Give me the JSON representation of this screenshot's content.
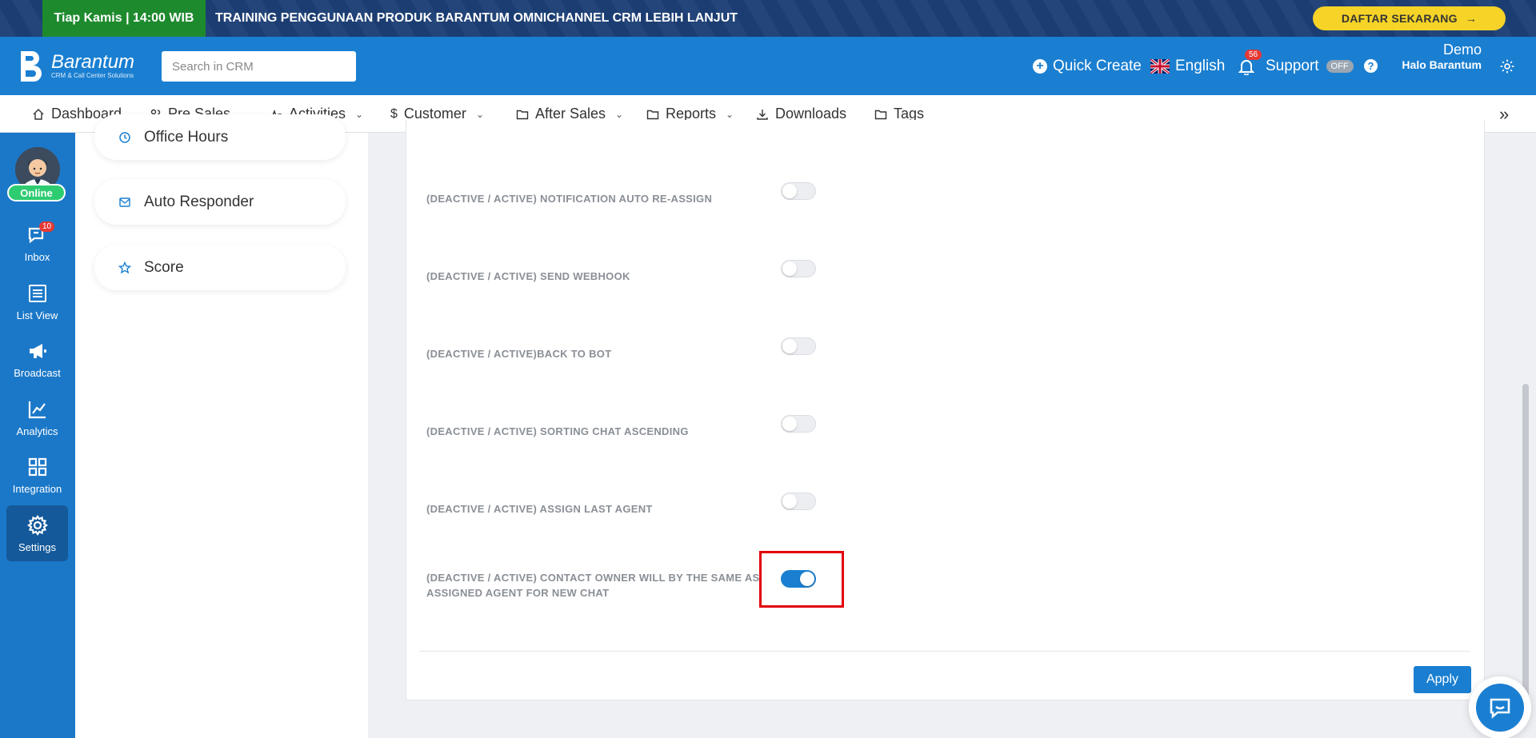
{
  "promo": {
    "badge": "Tiap Kamis | 14:00 WIB",
    "text": "TRAINING PENGGUNAAN PRODUK BARANTUM OMNICHANNEL CRM LEBIH LANJUT",
    "cta": "DAFTAR SEKARANG"
  },
  "header": {
    "brand": "Barantum",
    "brand_sub": "CRM & Call Center Solutions",
    "search_placeholder": "Search in CRM",
    "quick_create": "Quick Create",
    "language": "English",
    "notif_count": "56",
    "support": "Support",
    "support_status": "OFF",
    "help": "?",
    "user_name": "Demo",
    "user_sub": "Halo Barantum"
  },
  "nav": {
    "items": [
      {
        "label": "Dashboard",
        "icon": "home-icon"
      },
      {
        "label": "Pre Sales",
        "icon": "users-icon"
      },
      {
        "label": "Activities",
        "icon": "activity-icon"
      },
      {
        "label": "Customer",
        "icon": "dollar-icon"
      },
      {
        "label": "After Sales",
        "icon": "folder-icon"
      },
      {
        "label": "Reports",
        "icon": "folder-icon"
      },
      {
        "label": "Downloads",
        "icon": "download-icon"
      },
      {
        "label": "Tags",
        "icon": "folder-icon"
      }
    ],
    "more": "»"
  },
  "rail": {
    "status": "Online",
    "inbox_count": "10",
    "items": [
      "Inbox",
      "List View",
      "Broadcast",
      "Analytics",
      "Integration",
      "Settings"
    ]
  },
  "submenu": {
    "items": [
      "Office Hours",
      "Auto Responder",
      "Score"
    ]
  },
  "settings": {
    "rows": [
      {
        "label": "(DEACTIVE / ACTIVE) NOTIFICATION AUTO RE-ASSIGN",
        "enabled": false
      },
      {
        "label": "(DEACTIVE / ACTIVE) SEND WEBHOOK",
        "enabled": false
      },
      {
        "label": "(DEACTIVE / ACTIVE)BACK TO BOT",
        "enabled": false
      },
      {
        "label": "(DEACTIVE / ACTIVE) SORTING CHAT ASCENDING",
        "enabled": false
      },
      {
        "label": "(DEACTIVE / ACTIVE) ASSIGN LAST AGENT",
        "enabled": false
      },
      {
        "label": "(DEACTIVE / ACTIVE) CONTACT OWNER WILL BY THE SAME AS ASSIGNED AGENT FOR NEW CHAT",
        "enabled": true
      }
    ],
    "apply_label": "Apply"
  },
  "colors": {
    "primary": "#1a7fd1",
    "promo_bg": "#1c3f75",
    "promo_badge": "#1e8a2e",
    "cta": "#f5d327",
    "highlight": "#e3000b",
    "online": "#2ecc71"
  }
}
